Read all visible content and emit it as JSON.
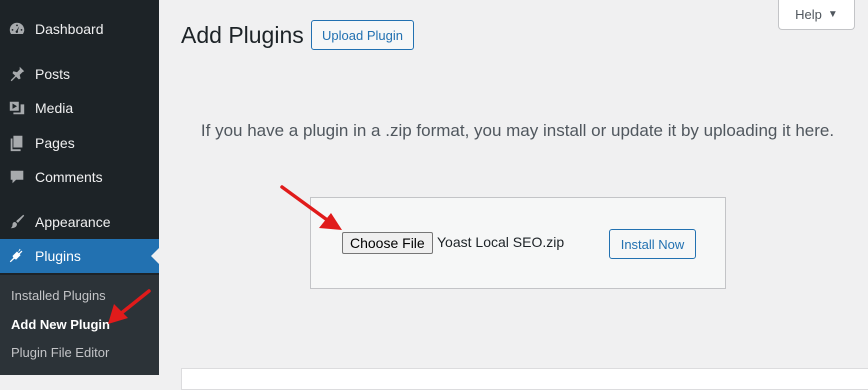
{
  "sidebar": {
    "items": [
      {
        "label": "Dashboard",
        "icon": "dashboard-icon"
      },
      {
        "label": "Posts",
        "icon": "pin-icon"
      },
      {
        "label": "Media",
        "icon": "media-icon"
      },
      {
        "label": "Pages",
        "icon": "pages-icon"
      },
      {
        "label": "Comments",
        "icon": "comment-icon"
      },
      {
        "label": "Appearance",
        "icon": "brush-icon"
      },
      {
        "label": "Plugins",
        "icon": "plugin-icon",
        "active": true
      }
    ],
    "submenu": [
      {
        "label": "Installed Plugins"
      },
      {
        "label": "Add New Plugin",
        "current": true
      },
      {
        "label": "Plugin File Editor"
      }
    ]
  },
  "header": {
    "title": "Add Plugins",
    "upload_button": "Upload Plugin",
    "help_label": "Help",
    "help_caret": "▼"
  },
  "upload": {
    "description": "If you have a plugin in a .zip format, you may install or update it by uploading it here.",
    "choose_file_label": "Choose File",
    "file_name": "Yoast Local SEO.zip",
    "install_button": "Install Now"
  },
  "colors": {
    "sidebar_bg": "#1d2327",
    "active": "#2271b1",
    "annotation_arrow": "#e01b1b"
  }
}
